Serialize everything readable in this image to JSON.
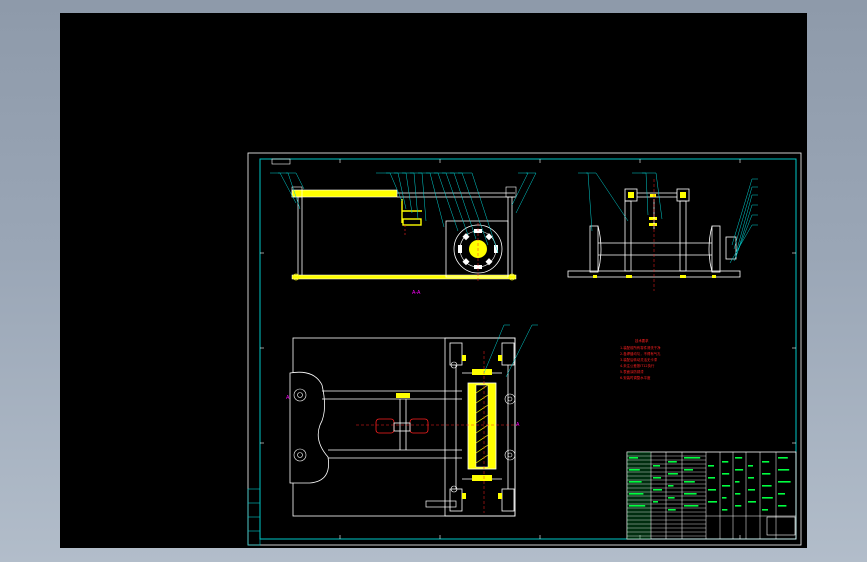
{
  "view": {
    "background": "#000000",
    "frame_color": "#00c8c8",
    "line_color": "#ffffff",
    "highlight_color": "#ffff00",
    "leader_color": "#00d2d2",
    "note_color": "#ff2020",
    "table_text_color": "#00ff40",
    "marker_color": "#ff00ff"
  },
  "sheet": {
    "section_label": "A-A",
    "notes_title": "技术要求",
    "notes": [
      "1.装配前所有零件清洗干净",
      "2.各焊缝均匀，不得有气孔",
      "3.装配后转动灵活无卡滞",
      "4.未注公差按IT12执行",
      "5.表面涂防锈漆",
      "6.安装时调整水平度"
    ]
  }
}
